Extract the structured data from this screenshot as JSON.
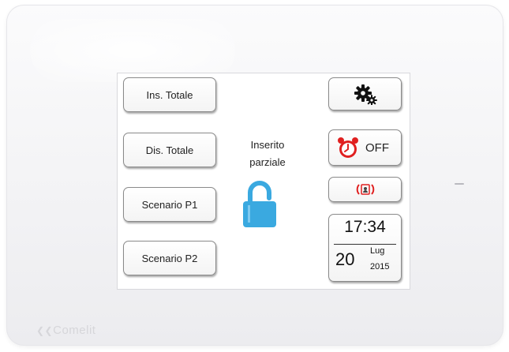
{
  "device": {
    "brand": "Comelit"
  },
  "screen": {
    "left_buttons": [
      {
        "label": "Ins. Totale"
      },
      {
        "label": "Dis. Totale"
      },
      {
        "label": "Scenario P1"
      },
      {
        "label": "Scenario P2"
      }
    ],
    "status": {
      "line1": "Inserito",
      "line2": "parziale",
      "icon": "padlock-open-icon",
      "color": "#3aa9e0"
    },
    "right_buttons": {
      "settings": {
        "icon": "gears-icon"
      },
      "timer": {
        "icon": "alarm-clock-icon",
        "label": "OFF",
        "color": "#e02020"
      },
      "alert": {
        "icon": "intrusion-alarm-icon",
        "color": "#e02020"
      }
    },
    "clock": {
      "time": "17:34",
      "day": "20",
      "month": "Lug",
      "year": "2015"
    }
  }
}
